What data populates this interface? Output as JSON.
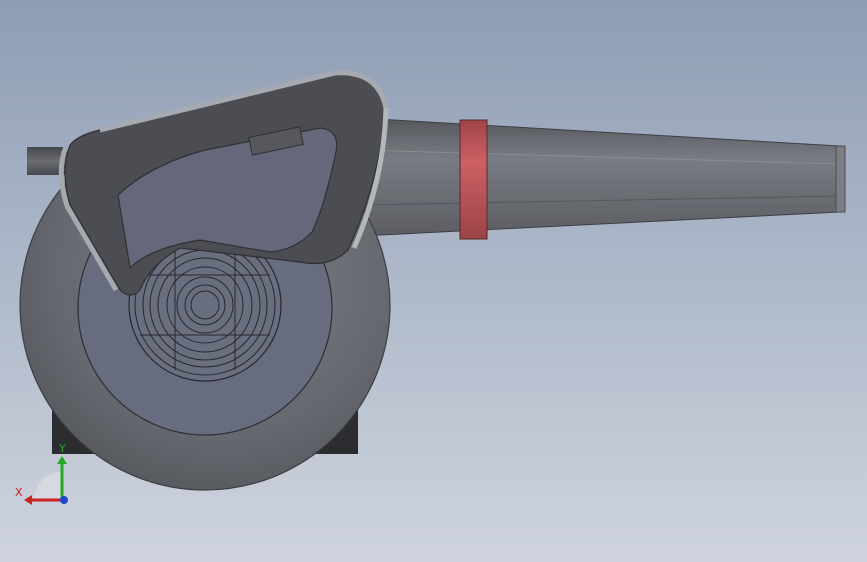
{
  "colors": {
    "background_top": "#8e9db5",
    "background_bottom": "#cfd4de",
    "body_dark": "#5f6168",
    "body_mid": "#6e7077",
    "nozzle": "#6a6c73",
    "nozzle_band": "#c0575a",
    "handle": "#4b4d52",
    "handle_edge": "#a6a9af",
    "intake": "#666c7f",
    "axis_x": "#cc2222",
    "axis_y": "#22aa22",
    "axis_z": "#2244cc"
  },
  "triad": {
    "x_label": "X",
    "y_label": "Y"
  }
}
